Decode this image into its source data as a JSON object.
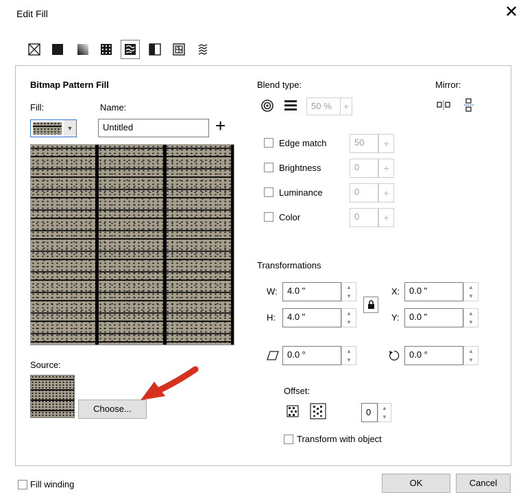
{
  "window": {
    "title": "Edit Fill",
    "close_glyph": "✕"
  },
  "toolbar": {
    "icons": [
      "no-fill-icon",
      "uniform-fill-icon",
      "fountain-fill-icon",
      "vector-pattern-fill-icon",
      "bitmap-pattern-fill-icon",
      "two-color-pattern-fill-icon",
      "texture-fill-icon",
      "postscript-fill-icon"
    ],
    "selected": "bitmap-pattern-fill-icon"
  },
  "section_title": "Bitmap Pattern Fill",
  "fill": {
    "label": "Fill:",
    "dropdown_arrow": "▼"
  },
  "name": {
    "label": "Name:",
    "value": "Untitled",
    "add_glyph": "+"
  },
  "blend": {
    "label": "Blend type:",
    "value": "50 %",
    "spin_glyph": "+"
  },
  "mirror": {
    "label": "Mirror:"
  },
  "options": [
    {
      "label": "Edge match",
      "value": "50",
      "checked": false
    },
    {
      "label": "Brightness",
      "value": "0",
      "checked": false
    },
    {
      "label": "Luminance",
      "value": "0",
      "checked": false
    },
    {
      "label": "Color",
      "value": "0",
      "checked": false
    }
  ],
  "transformations": {
    "label": "Transformations",
    "w_label": "W:",
    "w_value": "4.0 \"",
    "h_label": "H:",
    "h_value": "4.0 \"",
    "x_label": "X:",
    "x_value": "0.0 \"",
    "y_label": "Y:",
    "y_value": "0.0 \"",
    "skew_value": "0.0 °",
    "rotate_value": "0.0 °",
    "lock_glyph": "🔒"
  },
  "source": {
    "label": "Source:",
    "choose_label": "Choose..."
  },
  "offset": {
    "label": "Offset:",
    "value": "0"
  },
  "transform_with_object": {
    "label": "Transform with object",
    "checked": false
  },
  "fill_winding": {
    "label": "Fill winding",
    "checked": false
  },
  "buttons": {
    "ok": "OK",
    "cancel": "Cancel"
  },
  "colors": {
    "accent_arrow": "#d8301e",
    "pattern": "#a59e8d"
  }
}
